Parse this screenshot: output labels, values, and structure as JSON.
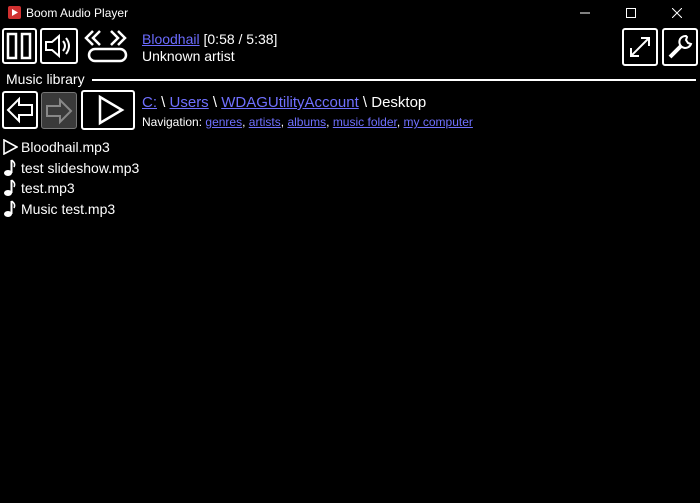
{
  "window": {
    "title": "Boom Audio Player",
    "minimize": "—",
    "maximize": "☐",
    "close": "✕"
  },
  "player": {
    "song_title": "Bloodhail",
    "time": "[0:58 / 5:38]",
    "artist": "Unknown artist"
  },
  "library": {
    "header": "Music library",
    "path": {
      "drive": "C:",
      "sep": " \\ ",
      "folder1": "Users",
      "folder2": "WDAGUtilityAccount",
      "current": "Desktop"
    },
    "navigation": {
      "label": "Navigation:",
      "links": [
        "genres",
        "artists",
        "albums",
        "music folder",
        "my computer"
      ]
    },
    "files": [
      {
        "name": "Bloodhail.mp3",
        "icon": "play-icon"
      },
      {
        "name": "test slideshow.mp3",
        "icon": "music-note-icon"
      },
      {
        "name": "test.mp3",
        "icon": "music-note-icon"
      },
      {
        "name": "Music test.mp3",
        "icon": "music-note-icon"
      }
    ]
  }
}
